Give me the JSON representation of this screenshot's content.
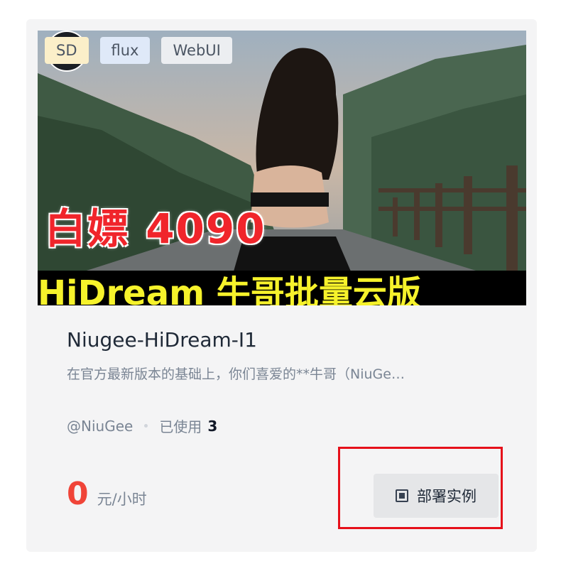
{
  "card": {
    "tags": [
      "SD",
      "flux",
      "WebUI"
    ],
    "cover_caption": "白嫖 4090",
    "cover_banner": "HiDream 牛哥批量云版",
    "title": "Niugee-HiDream-I1",
    "description": "在官方最新版本的基础上，你们喜爱的**牛哥（NiuGe…",
    "author": "@NiuGee",
    "usage_label": "已使用",
    "usage_count": "3",
    "price_value": "0",
    "price_unit": "元/小时",
    "deploy_label": "部署实例"
  },
  "colors": {
    "accent_price": "#f04438",
    "highlight_box": "#e6101a",
    "banner_text": "#f6f22b",
    "caption_text": "#f0252b"
  },
  "icons": {
    "deploy": "instance-icon",
    "avatar": "channel-logo"
  }
}
